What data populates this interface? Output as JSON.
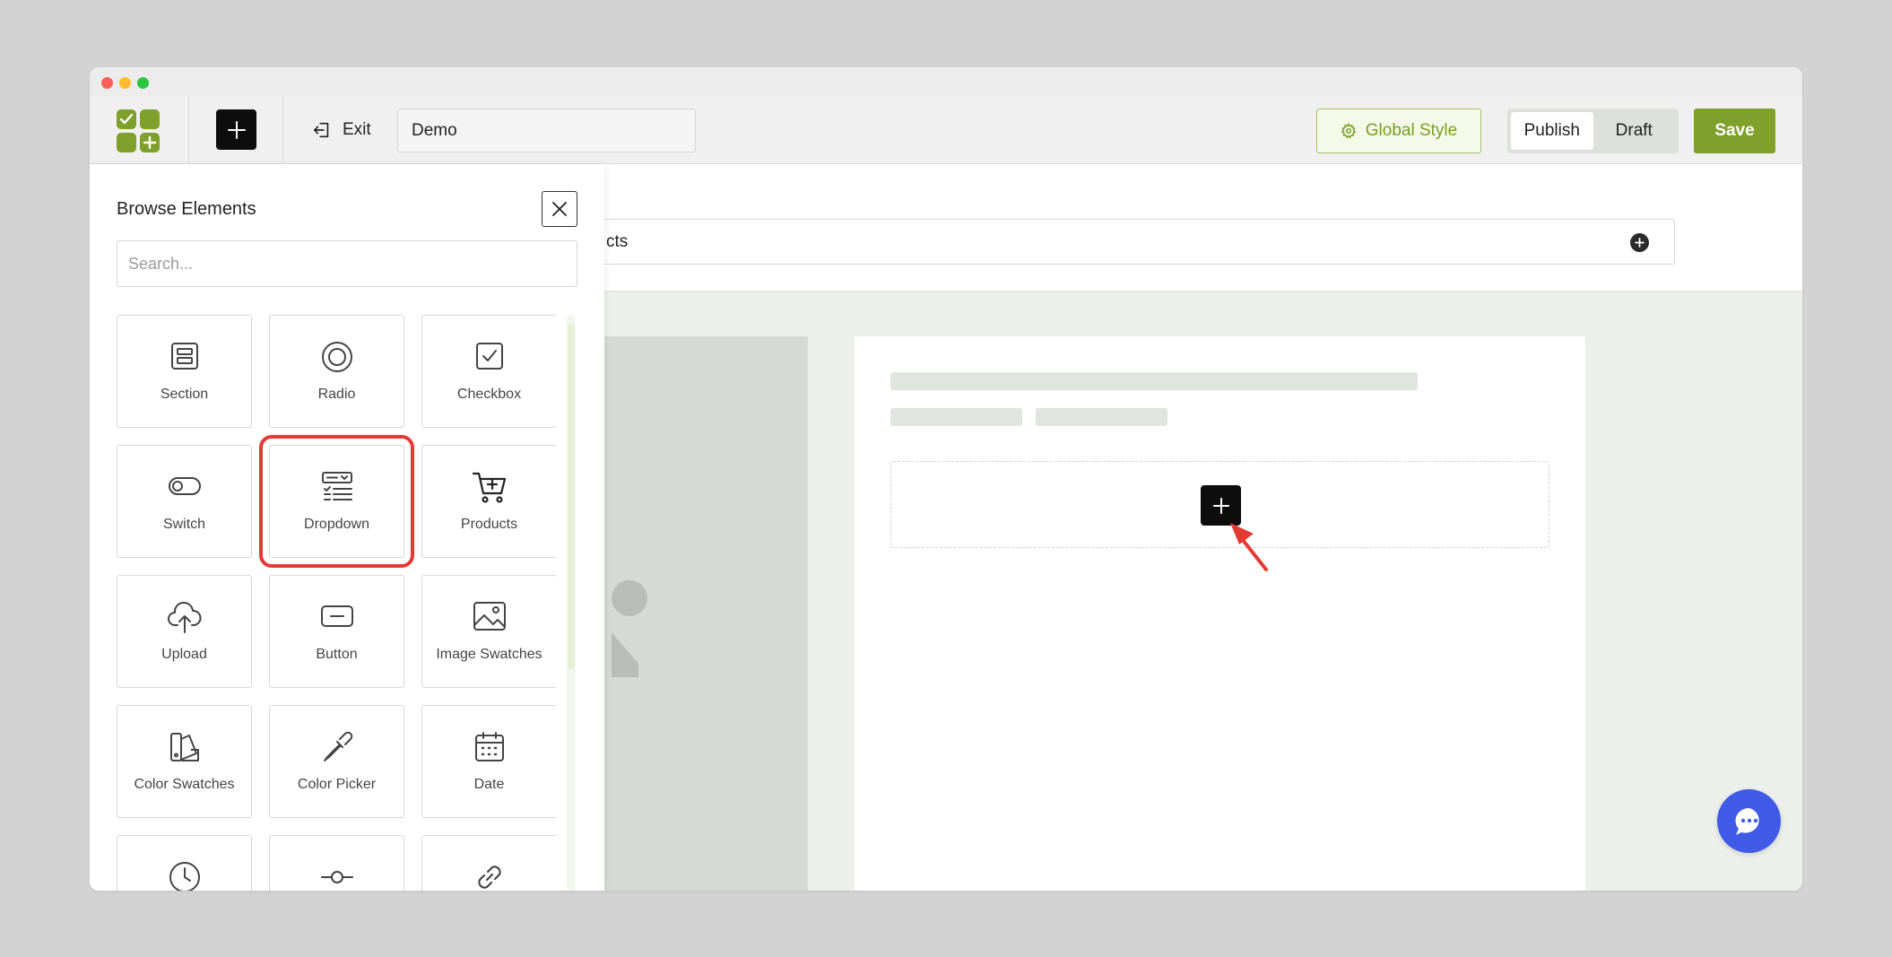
{
  "window": {
    "controls": [
      "close",
      "minimize",
      "zoom"
    ]
  },
  "toolbar": {
    "logo_icon": "app-logo-icon",
    "add_icon": "plus-icon",
    "exit_label": "Exit",
    "exit_icon": "exit-icon",
    "name_value": "Demo",
    "global_style_label": "Global Style",
    "global_style_icon": "gear-icon",
    "publish_label": "Publish",
    "draft_label": "Draft",
    "active_status": "Publish",
    "save_label": "Save"
  },
  "canvas": {
    "products_field_text": "cts",
    "add_element_icon": "plus-icon"
  },
  "panel": {
    "title": "Browse Elements",
    "close_icon": "close-icon",
    "search_placeholder": "Search...",
    "selected_element": "Dropdown",
    "elements": [
      {
        "label": "Section",
        "icon": "section-icon"
      },
      {
        "label": "Radio",
        "icon": "radio-icon"
      },
      {
        "label": "Checkbox",
        "icon": "checkbox-icon"
      },
      {
        "label": "Switch",
        "icon": "switch-icon"
      },
      {
        "label": "Dropdown",
        "icon": "dropdown-icon"
      },
      {
        "label": "Products",
        "icon": "cart-icon"
      },
      {
        "label": "Upload",
        "icon": "upload-icon"
      },
      {
        "label": "Button",
        "icon": "button-icon"
      },
      {
        "label": "Image Swatches",
        "icon": "image-icon"
      },
      {
        "label": "Color Swatches",
        "icon": "color-swatches-icon"
      },
      {
        "label": "Color Picker",
        "icon": "eyedropper-icon"
      },
      {
        "label": "Date",
        "icon": "calendar-icon"
      },
      {
        "label": "",
        "icon": "clock-icon"
      },
      {
        "label": "",
        "icon": "slider-icon"
      },
      {
        "label": "",
        "icon": "link-icon"
      }
    ]
  },
  "chat_icon": "chat-icon",
  "colors": {
    "brand_green": "#7fa02b",
    "highlight_red": "#e53935",
    "chat_blue": "#3f5be8",
    "dark": "#0d0d0d"
  }
}
